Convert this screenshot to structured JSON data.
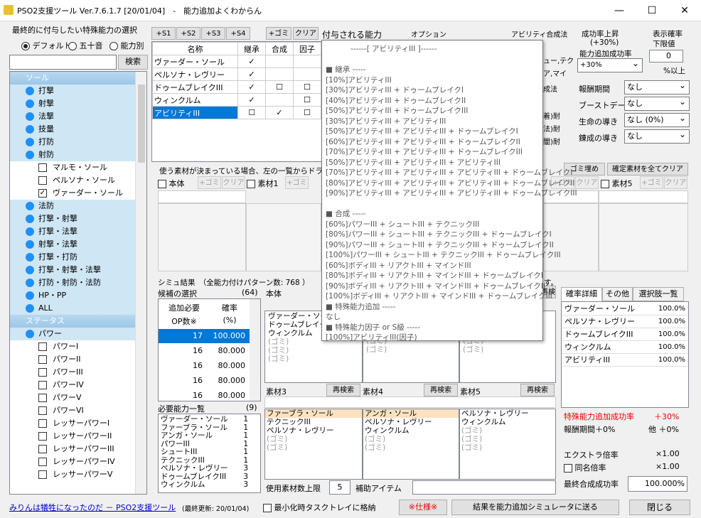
{
  "window": {
    "title": "PSO2支援ツール Ver.7.6.1.7 [20/01/04]　-　能力追加よくわからん",
    "min": "—",
    "max": "☐",
    "close": "✕"
  },
  "left": {
    "section_label": "最終的に付与したい特殊能力の選択",
    "sort": {
      "default": "デフォルト",
      "gojuon": "五十音",
      "ability": "能力別"
    },
    "search_placeholder": "",
    "search_btn": "検索",
    "tree": [
      {
        "t": "cat",
        "label": "ソール"
      },
      {
        "t": "grp",
        "label": "打撃"
      },
      {
        "t": "grp",
        "label": "射撃"
      },
      {
        "t": "grp",
        "label": "法撃"
      },
      {
        "t": "grp",
        "label": "技量"
      },
      {
        "t": "grp",
        "label": "打防"
      },
      {
        "t": "grp",
        "label": "射防"
      },
      {
        "t": "item",
        "label": "マルモ・ソール",
        "checked": ""
      },
      {
        "t": "item",
        "label": "ペルソナ・ソール",
        "checked": ""
      },
      {
        "t": "item",
        "label": "ヴァーダー・ソール",
        "checked": "✓"
      },
      {
        "t": "grp",
        "label": "法防"
      },
      {
        "t": "grp",
        "label": "打撃・射撃"
      },
      {
        "t": "grp",
        "label": "打撃・法撃"
      },
      {
        "t": "grp",
        "label": "射撃・法撃"
      },
      {
        "t": "grp",
        "label": "打撃・打防"
      },
      {
        "t": "grp",
        "label": "打撃・射撃・法撃"
      },
      {
        "t": "grp",
        "label": "打防・射防・法防"
      },
      {
        "t": "grp",
        "label": "HP・PP"
      },
      {
        "t": "grp",
        "label": "ALL"
      },
      {
        "t": "cat",
        "label": "ステータス"
      },
      {
        "t": "grp",
        "label": "パワー"
      },
      {
        "t": "item",
        "label": "パワーI",
        "checked": ""
      },
      {
        "t": "item",
        "label": "パワーII",
        "checked": ""
      },
      {
        "t": "item",
        "label": "パワーIII",
        "checked": ""
      },
      {
        "t": "item",
        "label": "パワーIV",
        "checked": ""
      },
      {
        "t": "item",
        "label": "パワーV",
        "checked": ""
      },
      {
        "t": "item",
        "label": "パワーVI",
        "checked": ""
      },
      {
        "t": "item",
        "label": "レッサーパワーI",
        "checked": ""
      },
      {
        "t": "item",
        "label": "レッサーパワーII",
        "checked": ""
      },
      {
        "t": "item",
        "label": "レッサーパワーIII",
        "checked": ""
      },
      {
        "t": "item",
        "label": "レッサーパワーIV",
        "checked": ""
      },
      {
        "t": "item",
        "label": "レッサーパワーV",
        "checked": ""
      }
    ]
  },
  "top": {
    "slot_btns": [
      "+S1",
      "+S2",
      "+S3",
      "+S4"
    ],
    "gomi": "+ゴミ",
    "clear": "クリア",
    "ability_label": "付与される能力",
    "col_name": "名称",
    "col_inherit": "継承",
    "col_synth": "合成",
    "col_factor": "因子",
    "rows": [
      {
        "name": "ヴァーダー・ソール",
        "inherit": "✓",
        "synth": "",
        "factor": ""
      },
      {
        "name": "ペルソナ・レヴリー",
        "inherit": "✓",
        "synth": "",
        "factor": ""
      },
      {
        "name": "ドゥームブレイクIII",
        "inherit": "✓",
        "synth": "☐",
        "factor": "☐"
      },
      {
        "name": "ウィンクルム",
        "inherit": "✓",
        "synth": "",
        "factor": "☐"
      },
      {
        "name": "アビリティIII",
        "inherit": "☐",
        "synth": "✓",
        "factor": "☐"
      }
    ],
    "option_label": "オプション",
    "ability_synth_label": "アビリティ合成法",
    "partial": [
      "ュー,テク",
      "ア,マイ",
      "成法",
      "着)耐",
      "法)耐",
      "闇)耐"
    ]
  },
  "right_top": {
    "rate_up": "成功率上昇",
    "rate_up_val": "(+30%)",
    "add_rate_label": "能力追加成功率",
    "add_rate_val": "+30%",
    "show_label": "表示確率",
    "lower_label": "下限値",
    "lower_val": "0",
    "pct_over": "%以上",
    "reward_label": "報酬期間",
    "reward_val": "なし",
    "boost_label": "ブーストデー",
    "boost_val": "なし",
    "life_label": "生命の導き",
    "life_val": "なし (0%)",
    "forge_label": "錬成の導き",
    "forge_val": "なし"
  },
  "material": {
    "hint": "使う素材が決まっている場合、左の一覧からドラッ",
    "honntai": "本体",
    "gomi": "+ゴミ",
    "clear": "クリア",
    "mat1": "素材1",
    "mat5": "素材5",
    "gomi_fill": "ゴミ埋め",
    "clear_all": "確定素材を全てクリア"
  },
  "sim": {
    "label": "シミュ結果　（全能力付けパターン数: 768 ）",
    "trail": "す。",
    "cand_label": "候補の選択",
    "cand_count": "(64)",
    "col_op": "追加必要",
    "col_op2": "OP数※",
    "col_rate": "確率",
    "col_rate2": "(%)",
    "cands": [
      {
        "op": "17",
        "rate": "100.000"
      },
      {
        "op": "16",
        "rate": "80.000"
      },
      {
        "op": "16",
        "rate": "80.000"
      },
      {
        "op": "16",
        "rate": "80.000"
      },
      {
        "op": "16",
        "rate": "80.000"
      }
    ],
    "body_label": "本体",
    "research": "再検索",
    "mat3": "素材3",
    "mat4": "素材4",
    "mat5": "素材5",
    "body_items": [
      "ヴァーダー・ソール",
      "ドゥームブレイクIII",
      "ウィンクルム",
      "(ゴミ)",
      "(ゴミ)",
      "(ゴミ)"
    ],
    "m2": [
      "(ゴミ)",
      "(ゴミ)",
      "(ゴミ)"
    ],
    "m3": [
      "(ゴミ)",
      "(ゴミ)",
      "(ゴミ)"
    ],
    "need_label": "必要能力一覧",
    "need_count": "(9)",
    "needs": [
      {
        "n": "ヴァーダー・ソール",
        "c": "1"
      },
      {
        "n": "ファーブラ・ソール",
        "c": "1"
      },
      {
        "n": "アンガ・ソール",
        "c": "1"
      },
      {
        "n": "パワーIII",
        "c": "1"
      },
      {
        "n": "シュートIII",
        "c": "1"
      },
      {
        "n": "テクニックIII",
        "c": "1"
      },
      {
        "n": "ペルソナ・レヴリー",
        "c": "3"
      },
      {
        "n": "ドゥームブレイクIII",
        "c": "3"
      },
      {
        "n": "ウィンクルム",
        "c": "3"
      }
    ],
    "mat3_items": [
      "ファーブラ・ソール",
      "テクニックIII",
      "ペルソナ・レヴリー",
      "(ゴミ)",
      "(ゴミ)"
    ],
    "mat4_items": [
      "アンガ・ソール",
      "ペルソナ・レヴリー",
      "ウィンクルム",
      "(ゴミ)",
      "(ゴミ)"
    ],
    "mat5_items": [
      "ペルソナ・レヴリー",
      "ウィンクルム",
      "(ゴミ)",
      "(ゴミ)",
      "(ゴミ)"
    ],
    "max_label": "使用素材数上限",
    "max_val": "5",
    "aux_label": "補助アイテム"
  },
  "detail": {
    "tabs": [
      "確率詳細",
      "その他",
      "選択肢一覧"
    ],
    "rows": [
      {
        "n": "ヴァーダー・ソール",
        "v": "100.0%"
      },
      {
        "n": "ペルソナ・レヴリー",
        "v": "100.0%"
      },
      {
        "n": "ドゥームブレイクIII",
        "v": "100.0%"
      },
      {
        "n": "ウィンクルム",
        "v": "100.0%"
      },
      {
        "n": "アビリティIII",
        "v": "100.0%"
      }
    ],
    "special": "特殊能力追加成功率",
    "special_val": "＋30%",
    "reward": "報酬期間＋0%",
    "other": "他 ＋0%",
    "extra": "エクストラ倍率",
    "extra_val": "×1.00",
    "same": "同名倍率",
    "same_val": "×1.00",
    "final": "最終合成成功率",
    "final_val": "100.000%"
  },
  "bottom": {
    "link": "みりんは犠牲になったのだ － PSO2支援ツール",
    "updated": "(最終更新: 20/01/04)",
    "tray": "最小化時タスクトレイに格納",
    "spec": "※仕様※",
    "send": "結果を能力追加シミュレータに送る",
    "close": "閉じる"
  },
  "popup": [
    "------[ アビリティIII ]------",
    "",
    "■ 継承 -----",
    "[10%]アビリティIII",
    "[30%]アビリティIII + ドゥームブレイクI",
    "[40%]アビリティIII + ドゥームブレイクII",
    "[50%]アビリティIII + ドゥームブレイクIII",
    "[30%]アビリティIII + アビリティIII",
    "[50%]アビリティIII + アビリティIII + ドゥームブレイクI",
    "[60%]アビリティIII + アビリティIII + ドゥームブレイクII",
    "[70%]アビリティIII + アビリティIII + ドゥームブレイクIII",
    "[50%]アビリティIII + アビリティIII + アビリティIII",
    "[70%]アビリティIII + アビリティIII + アビリティIII + ドゥームブレイクI",
    "[80%]アビリティIII + アビリティIII + アビリティIII + ドゥームブレイクII",
    "[90%]アビリティIII + アビリティIII + アビリティIII + ドゥームブレイクIII",
    "",
    "■ 合成 -----",
    "[60%]パワーIII + シュートIII + テクニックIII",
    "[80%]パワーIII + シュートIII + テクニックIII + ドゥームブレイクI",
    "[90%]パワーIII + シュートIII + テクニックIII + ドゥームブレイクII",
    "[100%]パワーIII + シュートIII + テクニックIII + ドゥームブレイクIII",
    "[60%]ボディIII + リアクトIII + マインドIII",
    "[80%]ボディIII + リアクトIII + マインドIII + ドゥームブレイクI",
    "[90%]ボディIII + リアクトIII + マインドIII + ドゥームブレイクII",
    "[100%]ボディIII + リアクトIII + マインドIII + ドゥームブレイクIII",
    "■ 特殊能力追加 -----",
    "なし",
    "■ 特殊能力因子 or S級 -----",
    "[100%]アビリティIII(因子)"
  ]
}
